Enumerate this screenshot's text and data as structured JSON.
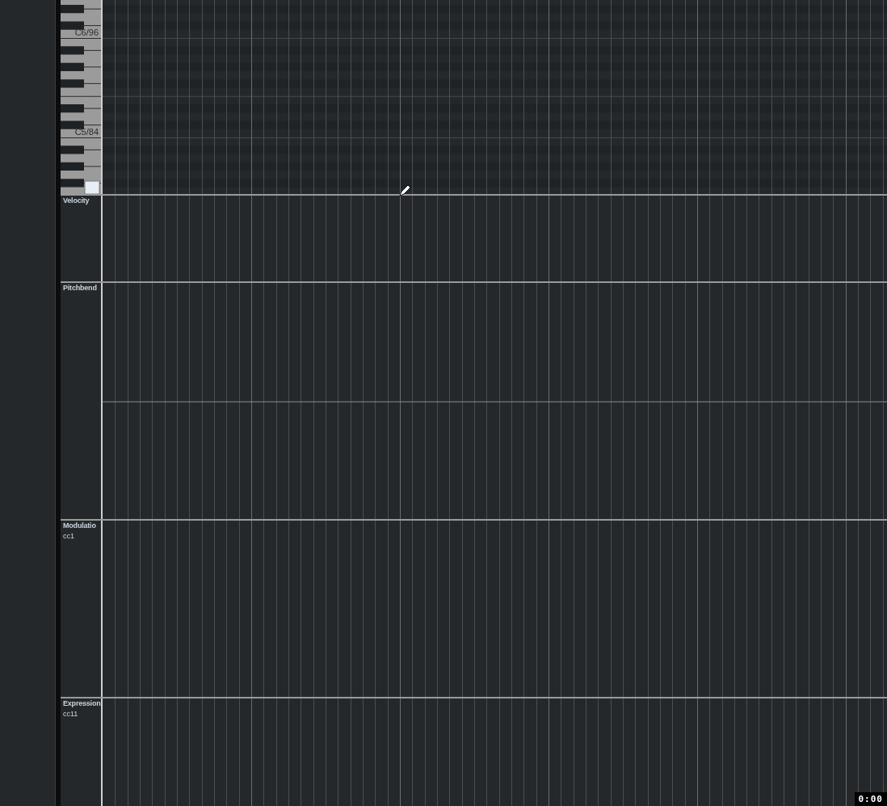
{
  "keyboard": {
    "labels": [
      "C6/96",
      "C5/84"
    ]
  },
  "lanes": [
    {
      "kind": "velocity",
      "name": "Velocity"
    },
    {
      "kind": "pitchbend",
      "name": "Pitchbend"
    },
    {
      "kind": "cc",
      "name": "Modulatio",
      "sub": "cc1"
    },
    {
      "kind": "cc",
      "name": "Expression",
      "sub": "cc11"
    }
  ],
  "time_display": "0:00"
}
